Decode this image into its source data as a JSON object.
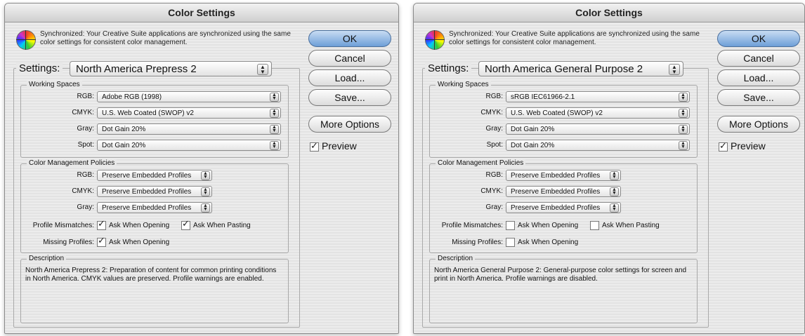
{
  "left": {
    "title": "Color Settings",
    "sync_text": "Synchronized: Your Creative Suite applications are synchronized using the same color settings for consistent color management.",
    "buttons": {
      "ok": "OK",
      "cancel": "Cancel",
      "load": "Load...",
      "save": "Save...",
      "more": "More Options"
    },
    "preview_label": "Preview",
    "settings_label": "Settings:",
    "settings_value": "North America Prepress 2",
    "working_spaces": {
      "label": "Working Spaces",
      "rgb_label": "RGB:",
      "rgb": "Adobe RGB (1998)",
      "cmyk_label": "CMYK:",
      "cmyk": "U.S. Web Coated (SWOP) v2",
      "gray_label": "Gray:",
      "gray": "Dot Gain 20%",
      "spot_label": "Spot:",
      "spot": "Dot Gain 20%"
    },
    "policies": {
      "label": "Color Management Policies",
      "rgb_label": "RGB:",
      "rgb": "Preserve Embedded Profiles",
      "cmyk_label": "CMYK:",
      "cmyk": "Preserve Embedded Profiles",
      "gray_label": "Gray:",
      "gray": "Preserve Embedded Profiles",
      "mismatch_label": "Profile Mismatches:",
      "ask_opening": "Ask When Opening",
      "ask_pasting": "Ask When Pasting",
      "missing_label": "Missing Profiles:",
      "missing_opening": "Ask When Opening"
    },
    "description": {
      "label": "Description",
      "text": "North America Prepress 2:  Preparation of content for common printing conditions in North America. CMYK values are preserved. Profile warnings are enabled."
    }
  },
  "right": {
    "title": "Color Settings",
    "sync_text": "Synchronized: Your Creative Suite applications are synchronized using the same color settings for consistent color management.",
    "buttons": {
      "ok": "OK",
      "cancel": "Cancel",
      "load": "Load...",
      "save": "Save...",
      "more": "More Options"
    },
    "preview_label": "Preview",
    "settings_label": "Settings:",
    "settings_value": "North America General Purpose 2",
    "working_spaces": {
      "label": "Working Spaces",
      "rgb_label": "RGB:",
      "rgb": "sRGB IEC61966-2.1",
      "cmyk_label": "CMYK:",
      "cmyk": "U.S. Web Coated (SWOP) v2",
      "gray_label": "Gray:",
      "gray": "Dot Gain 20%",
      "spot_label": "Spot:",
      "spot": "Dot Gain 20%"
    },
    "policies": {
      "label": "Color Management Policies",
      "rgb_label": "RGB:",
      "rgb": "Preserve Embedded Profiles",
      "cmyk_label": "CMYK:",
      "cmyk": "Preserve Embedded Profiles",
      "gray_label": "Gray:",
      "gray": "Preserve Embedded Profiles",
      "mismatch_label": "Profile Mismatches:",
      "ask_opening": "Ask When Opening",
      "ask_pasting": "Ask When Pasting",
      "missing_label": "Missing Profiles:",
      "missing_opening": "Ask When Opening"
    },
    "description": {
      "label": "Description",
      "text": "North America General Purpose 2:  General-purpose color settings for screen and print in North America. Profile warnings are disabled."
    }
  }
}
